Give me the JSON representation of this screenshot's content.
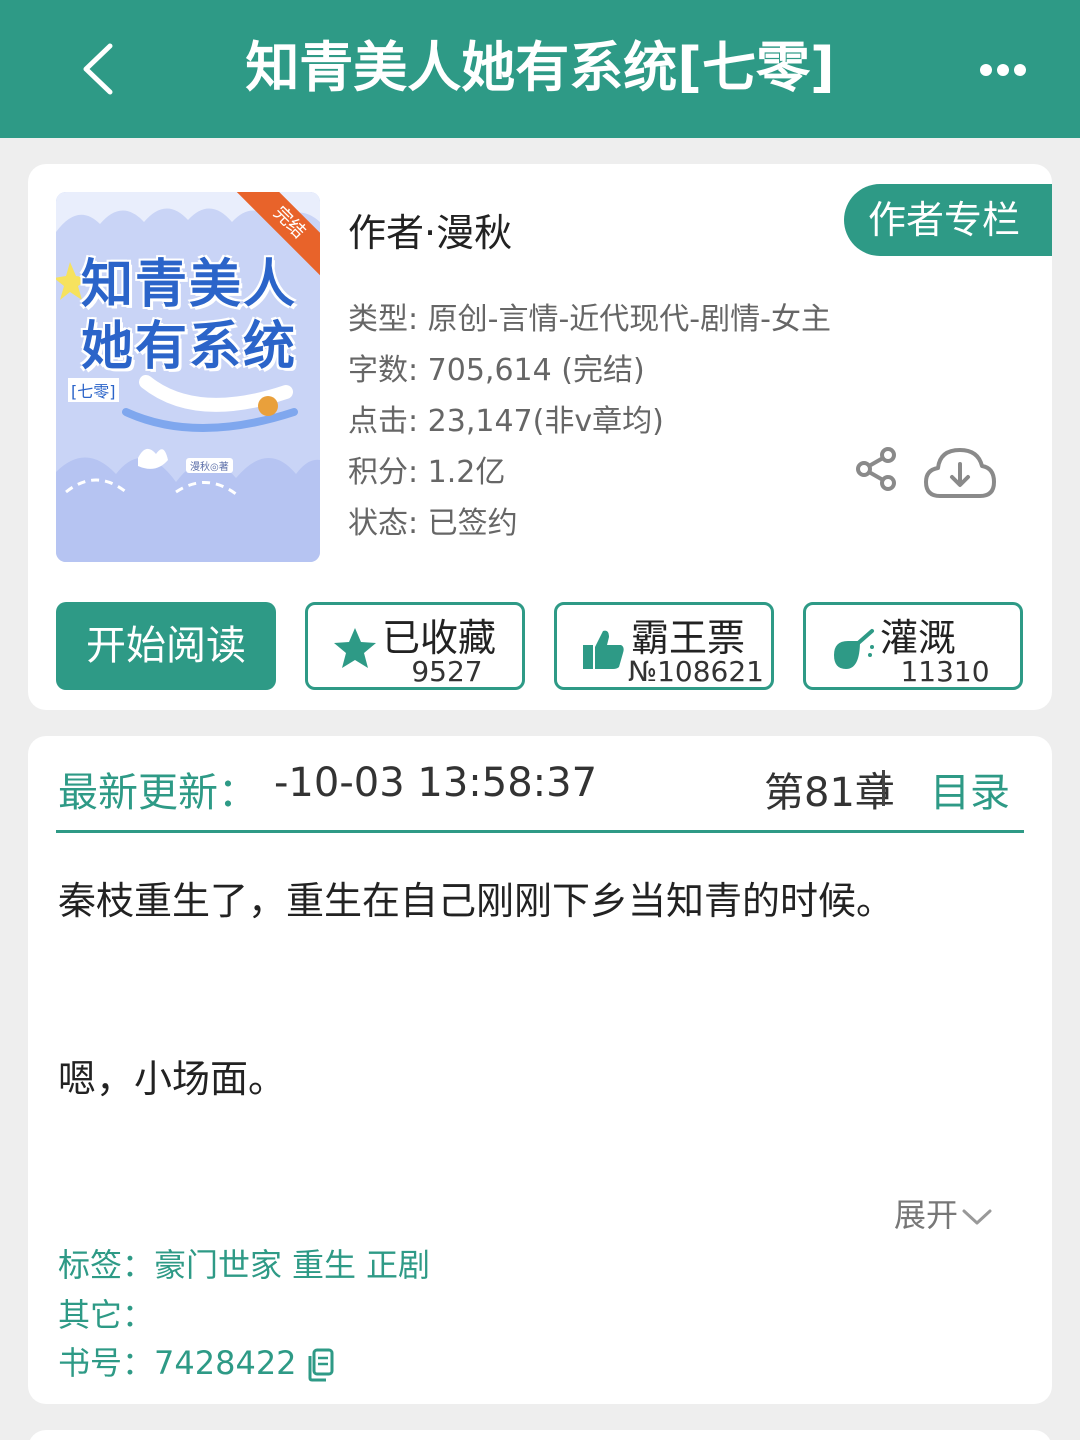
{
  "header": {
    "title": "知青美人她有系统[七零]"
  },
  "book": {
    "cover": {
      "title_line1": "知青美人",
      "title_line2": "她有系统",
      "subtitle": "[七零]",
      "badge": "完结",
      "author_mark": "漫秋◎著"
    },
    "author": "作者·漫秋",
    "author_column_label": "作者专栏",
    "info": {
      "genre": "类型: 原创-言情-近代现代-剧情-女主",
      "word_count": "字数: 705,614 (完结)",
      "clicks": "点击: 23,147(非v章均)",
      "points": "积分: 1.2亿",
      "status": "状态: 已签约"
    }
  },
  "actions": {
    "read_label": "开始阅读",
    "favorite": {
      "label": "已收藏",
      "count": "9527"
    },
    "ticket": {
      "label": "霸王票",
      "count": "№108621"
    },
    "water": {
      "label": "灌溉",
      "count": "11310"
    }
  },
  "update": {
    "label": "最新更新：",
    "time": "-10-03 13:58:37",
    "chapter": "第81章",
    "toc_label": "目录"
  },
  "description": {
    "line1": "秦枝重生了，重生在自己刚刚下乡当知青的时候。",
    "line2": "嗯，小场面。",
    "expand_label": "展开"
  },
  "meta": {
    "tags_label": "标签：",
    "tags": [
      "豪门世家",
      "重生",
      "正剧"
    ],
    "other_label": "其它：",
    "book_id_label": "书号：",
    "book_id": "7428422"
  },
  "icons": [
    "back-icon",
    "more-icon",
    "share-icon",
    "download-cloud-icon",
    "star-icon",
    "thumbs-up-icon",
    "watering-icon",
    "copy-icon",
    "chevron-down-icon"
  ],
  "colors": {
    "accent": "#2e9a86",
    "badge": "#e8632a",
    "cover_title": "#2b64c9"
  }
}
